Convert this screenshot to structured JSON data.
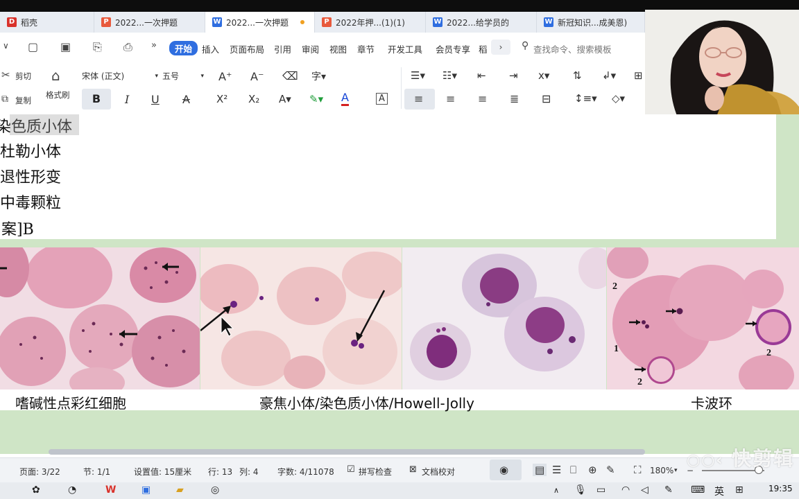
{
  "tabs": [
    {
      "label": "稻壳",
      "icon": "daoke-logo-icon",
      "color": "#d9322b"
    },
    {
      "label": "2022...一次押题",
      "icon": "pdf-doc-icon"
    },
    {
      "label": "2022...一次押题",
      "icon": "word-doc-icon",
      "active": true
    },
    {
      "label": "2022年押...(1)(1)",
      "icon": "pdf-doc-icon"
    },
    {
      "label": "2022...给学员的",
      "icon": "word-doc-icon"
    },
    {
      "label": "新冠知识...成美恩)",
      "icon": "word-doc-icon"
    }
  ],
  "menu": {
    "items": [
      "开始",
      "插入",
      "页面布局",
      "引用",
      "审阅",
      "视图",
      "章节",
      "开发工具",
      "会员专享",
      "稻"
    ],
    "more": "›",
    "search_placeholder": "查找命令、搜索模板"
  },
  "toolbar": {
    "cut": "剪切",
    "copy": "复制",
    "format_painter": "格式刷",
    "font_name": "宋体 (正文)",
    "font_size": "五号",
    "bold": "B",
    "italic": "I",
    "underline": "U",
    "strike": "A",
    "superscript": "X²",
    "subscript": "X₂",
    "font_color": "A",
    "text_box": "A"
  },
  "document": {
    "lines": [
      "染色质小体",
      "杜勒小体",
      "退性形变",
      "中毒颗粒",
      "案]B"
    ]
  },
  "image_captions": [
    "嗜碱性点彩红细胞",
    "豪焦小体/染色质小体/Howell-Jolly",
    "卡波环"
  ],
  "panel_labels": [
    "2",
    "1",
    "2",
    "2"
  ],
  "status": {
    "page": "页面: 3/22",
    "section": "节: 1/1",
    "setting": "设置值: 15厘米",
    "row": "行: 13",
    "col": "列: 4",
    "word_count": "字数: 4/11078",
    "spell_check": "拼写检查",
    "doc_proof": "文档校对",
    "zoom": "180%"
  },
  "watermark": "快剪辑",
  "taskbar": {
    "ime": "英",
    "time": "19:35"
  },
  "colors": {
    "accent": "#2f6ee0",
    "doc_background": "#cfe5c6",
    "tab_bar": "#e9edf3"
  }
}
